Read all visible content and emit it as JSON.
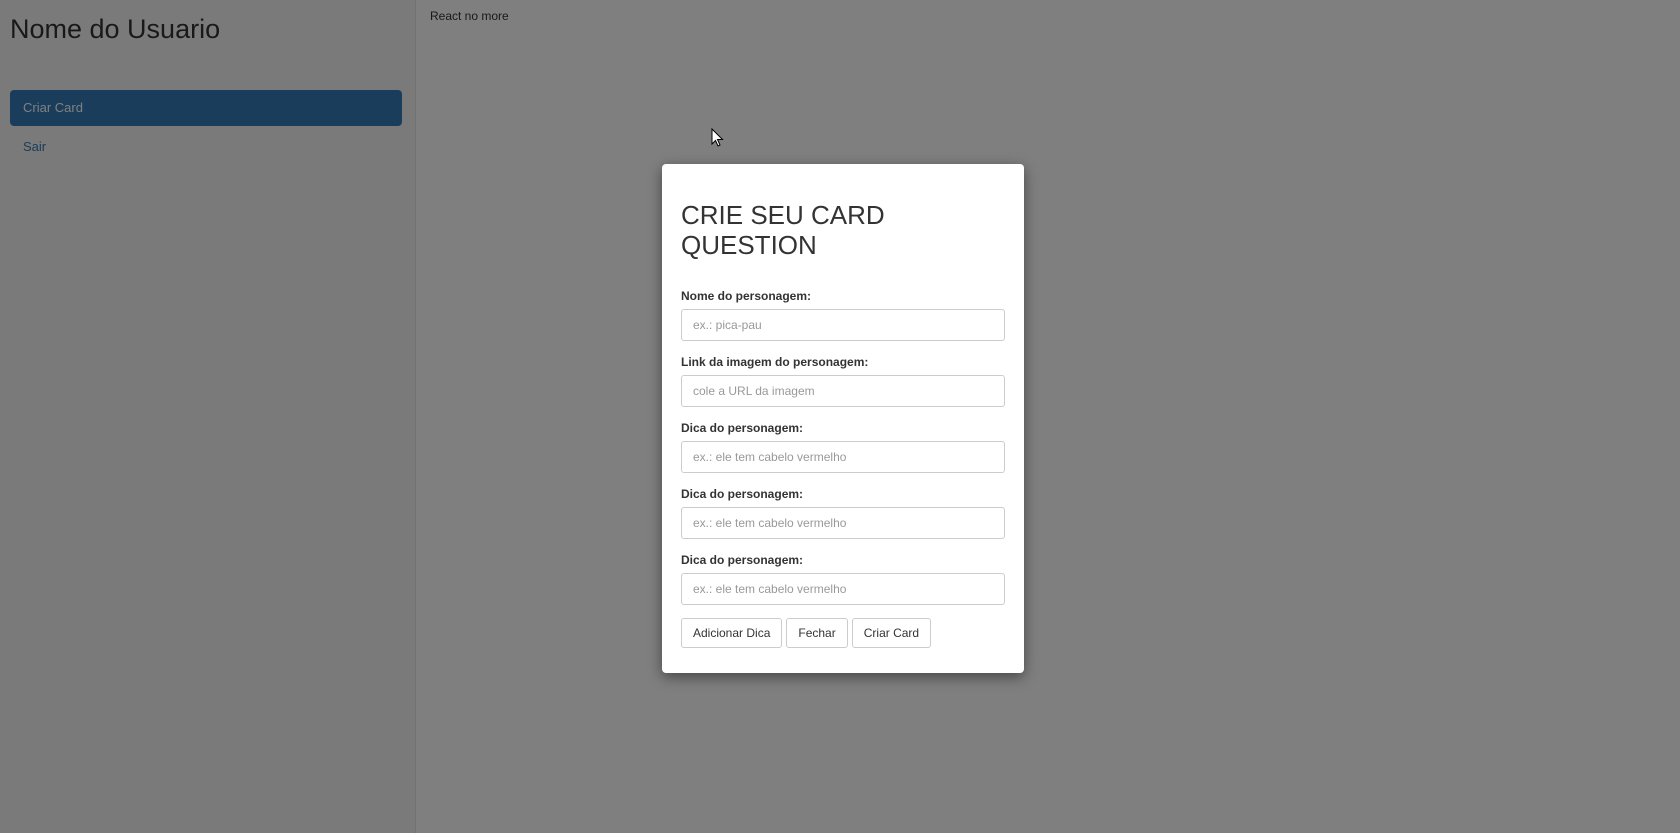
{
  "sidebar": {
    "user_name": "Nome do Usuario",
    "items": [
      {
        "label": "Criar Card",
        "active": true
      },
      {
        "label": "Sair",
        "active": false
      }
    ]
  },
  "main": {
    "text": "React no more"
  },
  "modal": {
    "title": "CRIE SEU CARD QUESTION",
    "fields": [
      {
        "label": "Nome do personagem:",
        "placeholder": "ex.: pica-pau",
        "value": ""
      },
      {
        "label": "Link da imagem do personagem:",
        "placeholder": "cole a URL da imagem",
        "value": ""
      },
      {
        "label": "Dica do personagem:",
        "placeholder": "ex.: ele tem cabelo vermelho",
        "value": ""
      },
      {
        "label": "Dica do personagem:",
        "placeholder": "ex.: ele tem cabelo vermelho",
        "value": ""
      },
      {
        "label": "Dica do personagem:",
        "placeholder": "ex.: ele tem cabelo vermelho",
        "value": ""
      }
    ],
    "buttons": {
      "add_hint": "Adicionar Dica",
      "close": "Fechar",
      "create": "Criar Card"
    }
  },
  "colors": {
    "primary": "#337ab7",
    "overlay": "rgba(0,0,0,0.5)"
  },
  "icons": {
    "cursor": "mouse-pointer-icon"
  }
}
